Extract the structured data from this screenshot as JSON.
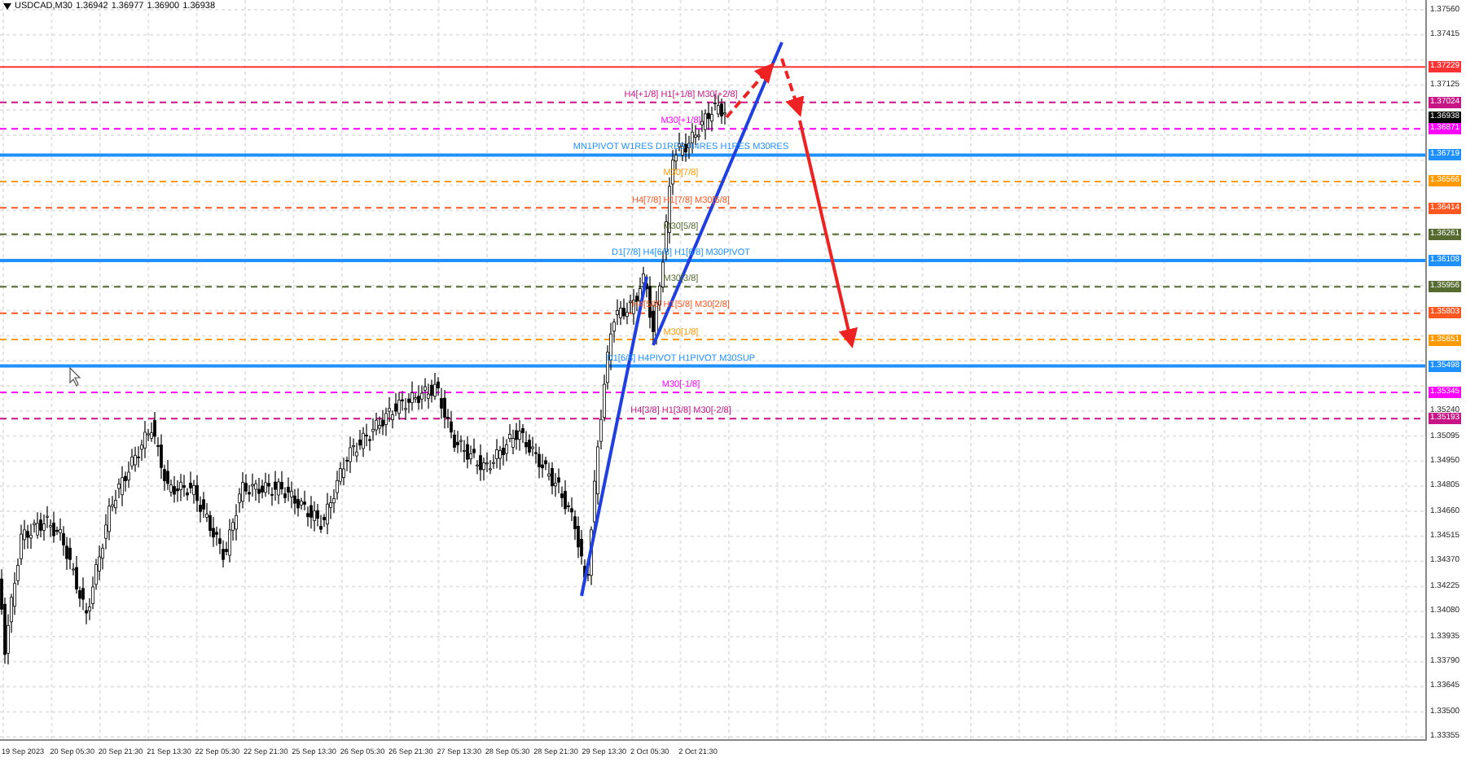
{
  "symbol": {
    "title": "USDCAD,M30",
    "quotes": [
      "1.36942",
      "1.36977",
      "1.36900",
      "1.36938"
    ]
  },
  "price_axis": {
    "ticks": [
      "1.37560",
      "1.37415",
      "1.37125",
      "1.35240",
      "1.35095",
      "1.34950",
      "1.34805",
      "1.34660",
      "1.34515",
      "1.34370",
      "1.34225",
      "1.34080",
      "1.33935",
      "1.33790",
      "1.33645",
      "1.33500",
      "1.33355"
    ]
  },
  "levels": [
    {
      "price": "1.37229",
      "color": "#ff3333",
      "kind": "solid"
    },
    {
      "price": "1.37024",
      "color": "#c71585",
      "kind": "dashed",
      "label": "H4[+1/8] H1[+1/8] M30[+2/8]"
    },
    {
      "price": "1.36938",
      "color": "#000000",
      "kind": "current"
    },
    {
      "price": "1.36871",
      "color": "#ff00ff",
      "kind": "dashed",
      "label": "M30[+1/8]"
    },
    {
      "price": "1.36719",
      "color": "#1e90ff",
      "kind": "solid",
      "label": "MN1PIVOT W1RES D1RES H4RES H1RES M30RES"
    },
    {
      "price": "1.36566",
      "color": "#ff9900",
      "kind": "dashed",
      "label": "M30[7/8]"
    },
    {
      "price": "1.36414",
      "color": "#ff5722",
      "kind": "dashed",
      "label": "H4[7/8] H1[7/8] M30[6/8]"
    },
    {
      "price": "1.36261",
      "color": "#556b2f",
      "kind": "dashed",
      "label": "M30[5/8]"
    },
    {
      "price": "1.36108",
      "color": "#1e90ff",
      "kind": "solid",
      "label": "D1[7/8] H4[6/8] H1[6/8] M30PIVOT"
    },
    {
      "price": "1.35956",
      "color": "#556b2f",
      "kind": "dashed",
      "label": "M30[3/8]"
    },
    {
      "price": "1.35803",
      "color": "#ff5722",
      "kind": "dashed",
      "label": "H4[5/8] H1[5/8] M30[2/8]"
    },
    {
      "price": "1.35651",
      "color": "#ff9900",
      "kind": "dashed",
      "label": "M30[1/8]"
    },
    {
      "price": "1.35498",
      "color": "#1e90ff",
      "kind": "solid",
      "label": "D1[6/8] H4PIVOT H1PIVOT M30SUP"
    },
    {
      "price": "1.35345",
      "color": "#ff00ff",
      "kind": "dashed",
      "label": "M30[-1/8]"
    },
    {
      "price": "1.35193",
      "color": "#c71585",
      "kind": "dashed",
      "label": "H4[3/8] H1[3/8] M30[-2/8]"
    }
  ],
  "time_axis": {
    "labels": [
      "19 Sep 2023",
      "20 Sep 05:30",
      "20 Sep 21:30",
      "21 Sep 13:30",
      "22 Sep 05:30",
      "22 Sep 21:30",
      "25 Sep 13:30",
      "26 Sep 05:30",
      "26 Sep 21:30",
      "27 Sep 13:30",
      "28 Sep 05:30",
      "28 Sep 21:30",
      "29 Sep 13:30",
      "2 Oct 05:30",
      "2 Oct 21:30"
    ]
  }
}
